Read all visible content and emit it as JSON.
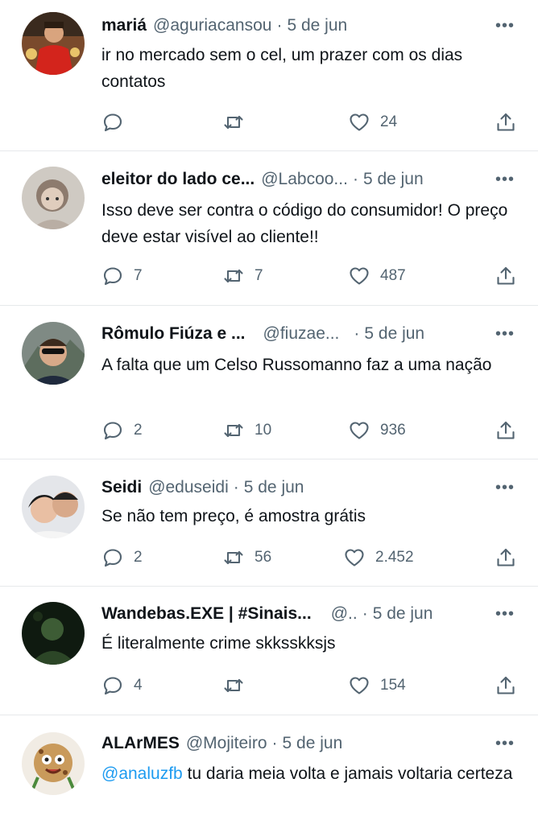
{
  "tweets": [
    {
      "name": "mariá",
      "handle": "@aguriacansou",
      "date": "5 de jun",
      "text": "ir no mercado sem o cel, um prazer com os dias contatos",
      "replies": "",
      "retweets": "",
      "likes": "24"
    },
    {
      "name": "eleitor do lado ce...",
      "handle": "@Labcoo...",
      "date": "5 de jun",
      "text": "Isso deve ser contra o código do consumidor! O preço deve estar visível ao cliente!!",
      "replies": "7",
      "retweets": "7",
      "likes": "487"
    },
    {
      "name": "Rômulo Fiúza e ...",
      "handle": "@fiuzae...",
      "date": "5 de jun",
      "text": "A falta que um Celso Russomanno faz a uma nação",
      "replies": "2",
      "retweets": "10",
      "likes": "936"
    },
    {
      "name": "Seidi",
      "handle": "@eduseidi",
      "date": "5 de jun",
      "text": "Se não tem preço, é amostra grátis",
      "replies": "2",
      "retweets": "56",
      "likes": "2.452"
    },
    {
      "name": "Wandebas.EXE | #Sinais...",
      "handle": "@..",
      "date": "5 de jun",
      "text": "É literalmente crime skksskksjs",
      "replies": "4",
      "retweets": "",
      "likes": "154"
    },
    {
      "name": "ALArMES",
      "handle": "@Mojiteiro",
      "date": "5 de jun",
      "mention": "@analuzfb",
      "text": "tu daria meia volta e jamais voltaria certeza",
      "replies": "",
      "retweets": "",
      "likes": ""
    }
  ],
  "ui": {
    "separator": "·",
    "more": "•••"
  }
}
